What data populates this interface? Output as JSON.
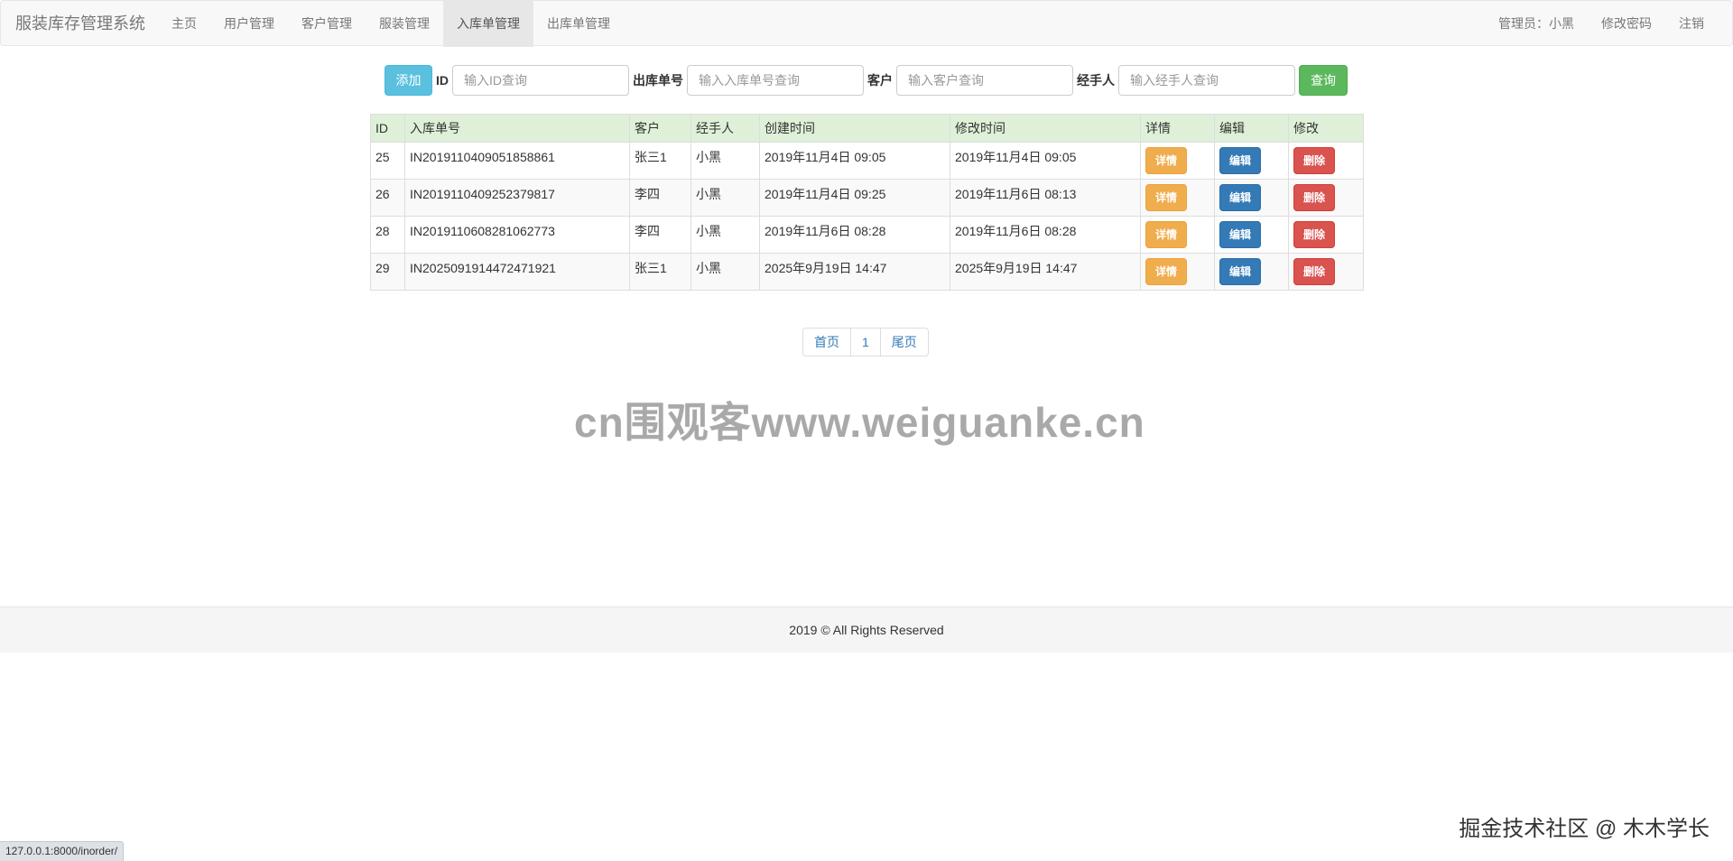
{
  "navbar": {
    "brand": "服装库存管理系统",
    "items": [
      {
        "label": "主页"
      },
      {
        "label": "用户管理"
      },
      {
        "label": "客户管理"
      },
      {
        "label": "服装管理"
      },
      {
        "label": "入库单管理"
      },
      {
        "label": "出库单管理"
      }
    ],
    "active_index": 4,
    "right": {
      "admin": "管理员：小黑",
      "change_password": "修改密码",
      "logout": "注销"
    }
  },
  "search": {
    "add_label": "添加",
    "id_label": "ID",
    "id_placeholder": "输入ID查询",
    "order_label": "出库单号",
    "order_placeholder": "输入入库单号查询",
    "customer_label": "客户",
    "customer_placeholder": "输入客户查询",
    "handler_label": "经手人",
    "handler_placeholder": "输入经手人查询",
    "query_label": "查询"
  },
  "table": {
    "headers": [
      "ID",
      "入库单号",
      "客户",
      "经手人",
      "创建时间",
      "修改时间",
      "详情",
      "编辑",
      "修改"
    ],
    "rows": [
      {
        "id": "25",
        "order_no": "IN2019110409051858861",
        "customer": "张三1",
        "handler": "小黑",
        "created": "2019年11月4日 09:05",
        "modified": "2019年11月4日 09:05"
      },
      {
        "id": "26",
        "order_no": "IN2019110409252379817",
        "customer": "李四",
        "handler": "小黑",
        "created": "2019年11月4日 09:25",
        "modified": "2019年11月6日 08:13"
      },
      {
        "id": "28",
        "order_no": "IN2019110608281062773",
        "customer": "李四",
        "handler": "小黑",
        "created": "2019年11月6日 08:28",
        "modified": "2019年11月6日 08:28"
      },
      {
        "id": "29",
        "order_no": "IN2025091914472471921",
        "customer": "张三1",
        "handler": "小黑",
        "created": "2025年9月19日 14:47",
        "modified": "2025年9月19日 14:47"
      }
    ],
    "detail_label": "详情",
    "edit_label": "编辑",
    "delete_label": "删除"
  },
  "pagination": {
    "first": "首页",
    "page": "1",
    "last": "尾页"
  },
  "watermark": "cn围观客www.weiguanke.cn",
  "footer": "2019 © All Rights Reserved",
  "signature": "掘金技术社区 @ 木木学长",
  "status_url": "127.0.0.1:8000/inorder/",
  "colors": {
    "info": "#5bc0de",
    "success": "#5cb85c",
    "warning": "#f0ad4e",
    "primary": "#337ab7",
    "danger": "#d9534f",
    "table_header": "#dff0d8"
  }
}
